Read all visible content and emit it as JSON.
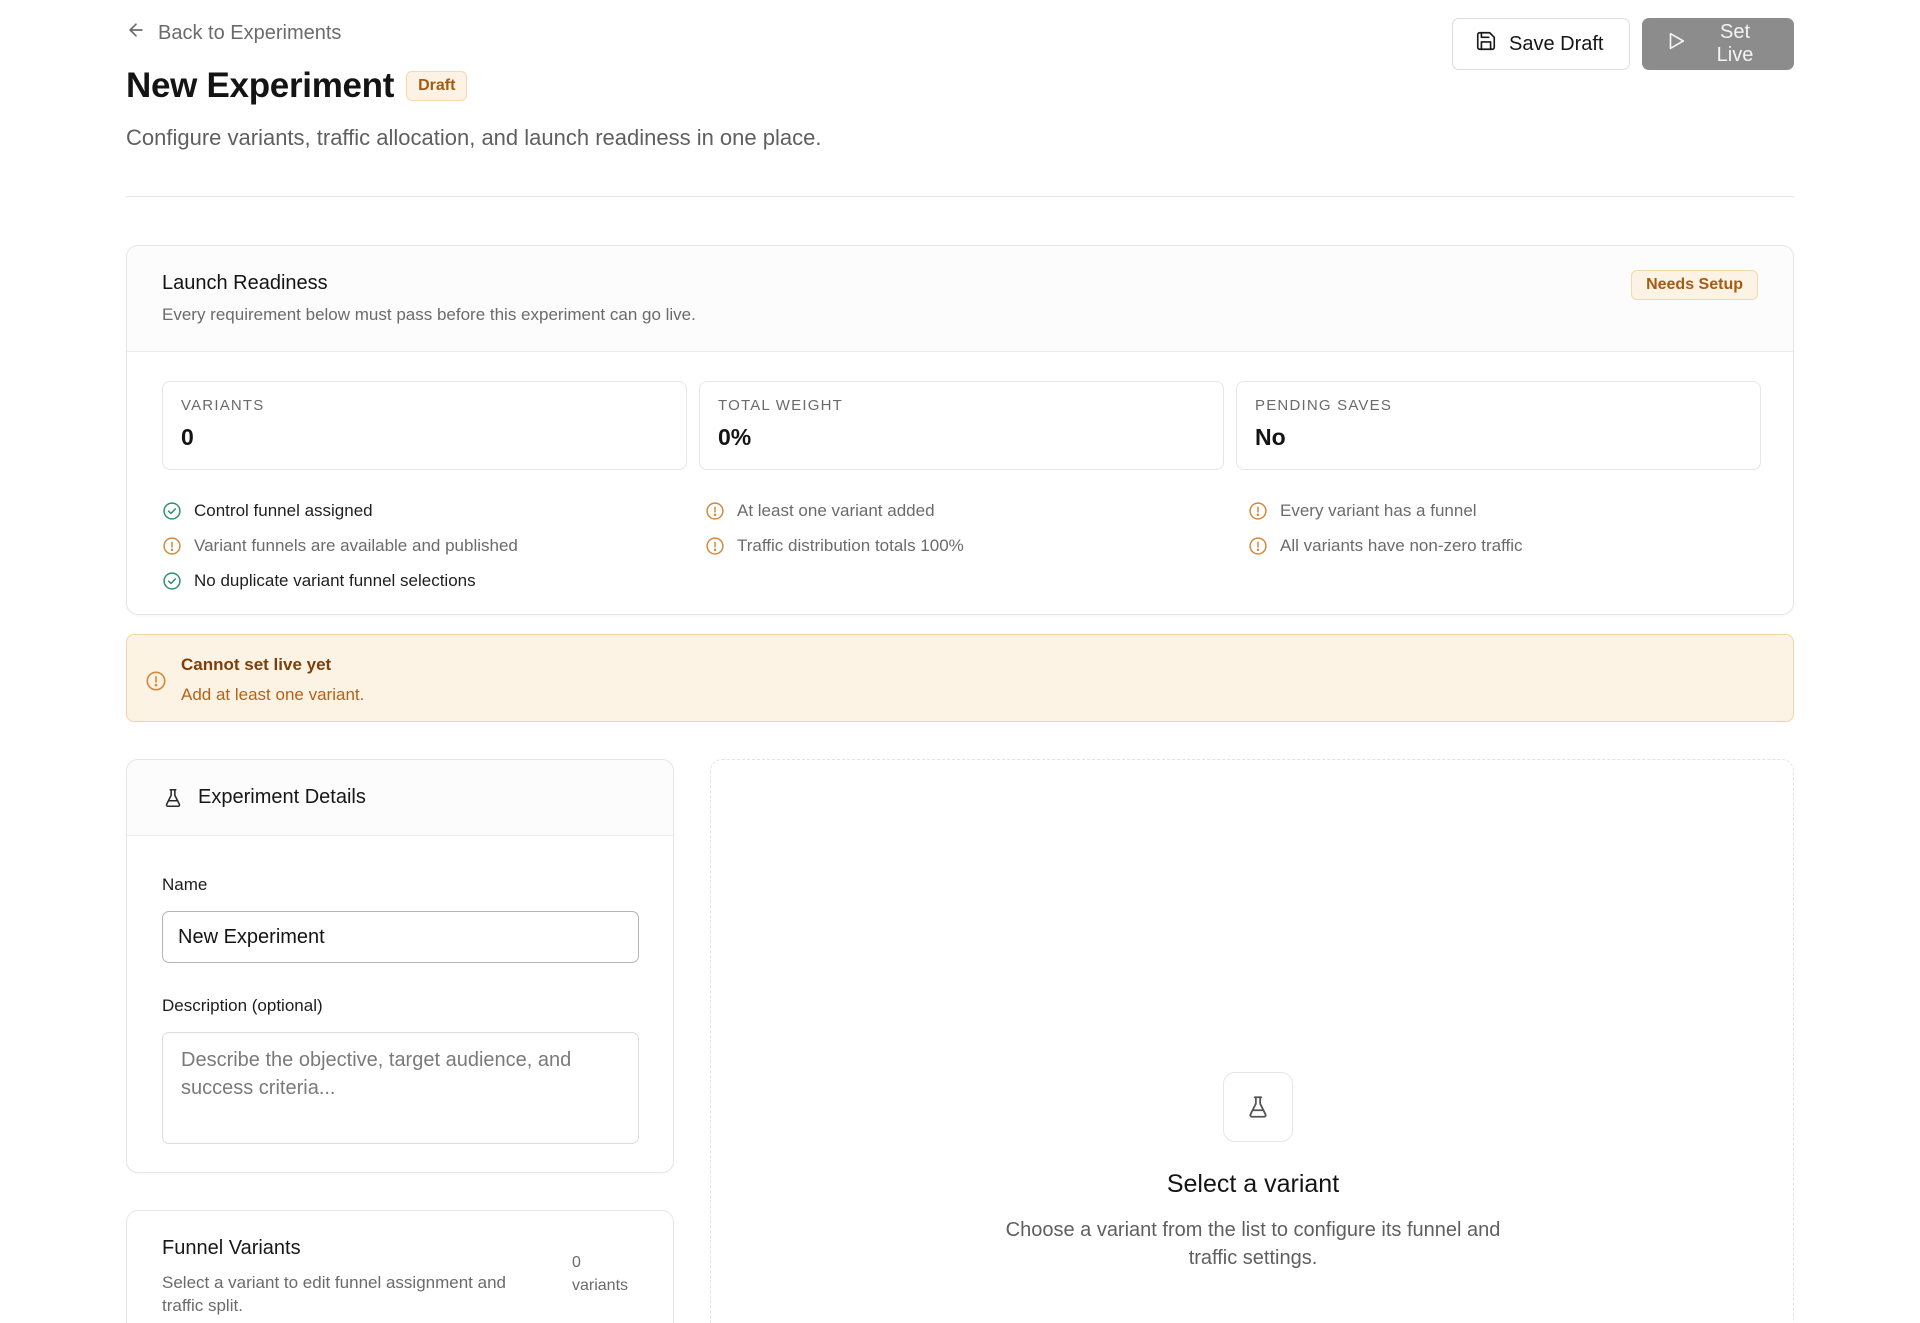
{
  "header": {
    "back_label": "Back to Experiments",
    "title": "New Experiment",
    "status_badge": "Draft",
    "subtitle": "Configure variants, traffic allocation, and launch readiness in one place.",
    "save_draft_label": "Save Draft",
    "set_live_label": "Set Live"
  },
  "readiness": {
    "title": "Launch Readiness",
    "description": "Every requirement below must pass before this experiment can go live.",
    "badge": "Needs Setup",
    "stats": [
      {
        "label": "Variants",
        "value": "0"
      },
      {
        "label": "Total Weight",
        "value": "0%"
      },
      {
        "label": "Pending Saves",
        "value": "No"
      }
    ],
    "checks": {
      "col1": [
        {
          "label": "Control funnel assigned",
          "status": "ok"
        },
        {
          "label": "Variant funnels are available and published",
          "status": "warn"
        },
        {
          "label": "No duplicate variant funnel selections",
          "status": "ok"
        }
      ],
      "col2": [
        {
          "label": "At least one variant added",
          "status": "warn"
        },
        {
          "label": "Traffic distribution totals 100%",
          "status": "warn"
        }
      ],
      "col3": [
        {
          "label": "Every variant has a funnel",
          "status": "warn"
        },
        {
          "label": "All variants have non-zero traffic",
          "status": "warn"
        }
      ]
    }
  },
  "alert": {
    "title": "Cannot set live yet",
    "message": "Add at least one variant."
  },
  "details": {
    "title": "Experiment Details",
    "name_label": "Name",
    "name_value": "New Experiment",
    "description_label": "Description (optional)",
    "description_placeholder": "Describe the objective, target audience, and success criteria..."
  },
  "variants": {
    "title": "Funnel Variants",
    "description": "Select a variant to edit funnel assignment and traffic split.",
    "count": "0",
    "count_unit": "variants"
  },
  "empty_state": {
    "title": "Select a variant",
    "description": "Choose a variant from the list to configure its funnel and traffic settings."
  },
  "colors": {
    "ok": "#2f8f6f",
    "warn": "#d4893a",
    "warn_bg": "#fdf3e4",
    "disabled_button": "#8c8c8c"
  },
  "icons": {
    "back": "arrow-left-icon",
    "save": "floppy-disk-icon",
    "live": "play-icon",
    "ok": "check-circle-icon",
    "warn": "alert-circle-icon",
    "experiment": "flask-icon"
  }
}
